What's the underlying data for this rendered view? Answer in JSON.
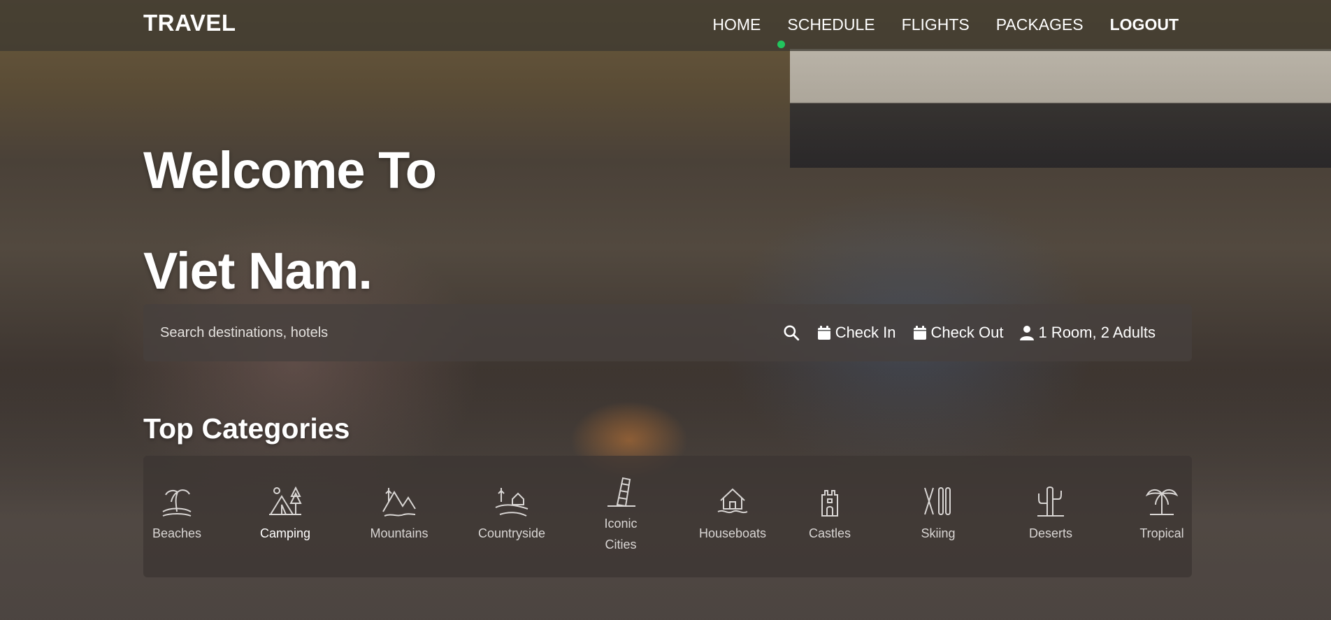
{
  "nav": {
    "brand": "TRAVEL",
    "items": [
      {
        "label": "HOME"
      },
      {
        "label": "SCHEDULE"
      },
      {
        "label": "FLIGHTS"
      },
      {
        "label": "PACKAGES"
      },
      {
        "label": "LOGOUT"
      }
    ],
    "active_indicator_color": "#22c55e"
  },
  "hero": {
    "line1": "Welcome To",
    "line2": "Viet Nam."
  },
  "search": {
    "placeholder": "Search destinations, hotels",
    "check_in": "Check In",
    "check_out": "Check Out",
    "guests": "1 Room, 2 Adults"
  },
  "categories": {
    "title": "Top Categories",
    "items": [
      {
        "label": "Beaches",
        "icon": "palm-island-icon"
      },
      {
        "label": "Camping",
        "icon": "tent-icon"
      },
      {
        "label": "Mountains",
        "icon": "mountains-icon"
      },
      {
        "label": "Countryside",
        "icon": "countryside-icon"
      },
      {
        "label": "Iconic Cities",
        "icon": "leaning-tower-icon"
      },
      {
        "label": "Houseboats",
        "icon": "houseboat-icon"
      },
      {
        "label": "Castles",
        "icon": "castle-icon"
      },
      {
        "label": "Skiing",
        "icon": "skis-icon"
      },
      {
        "label": "Deserts",
        "icon": "cactus-icon"
      },
      {
        "label": "Tropical",
        "icon": "tropical-icon"
      }
    ]
  }
}
